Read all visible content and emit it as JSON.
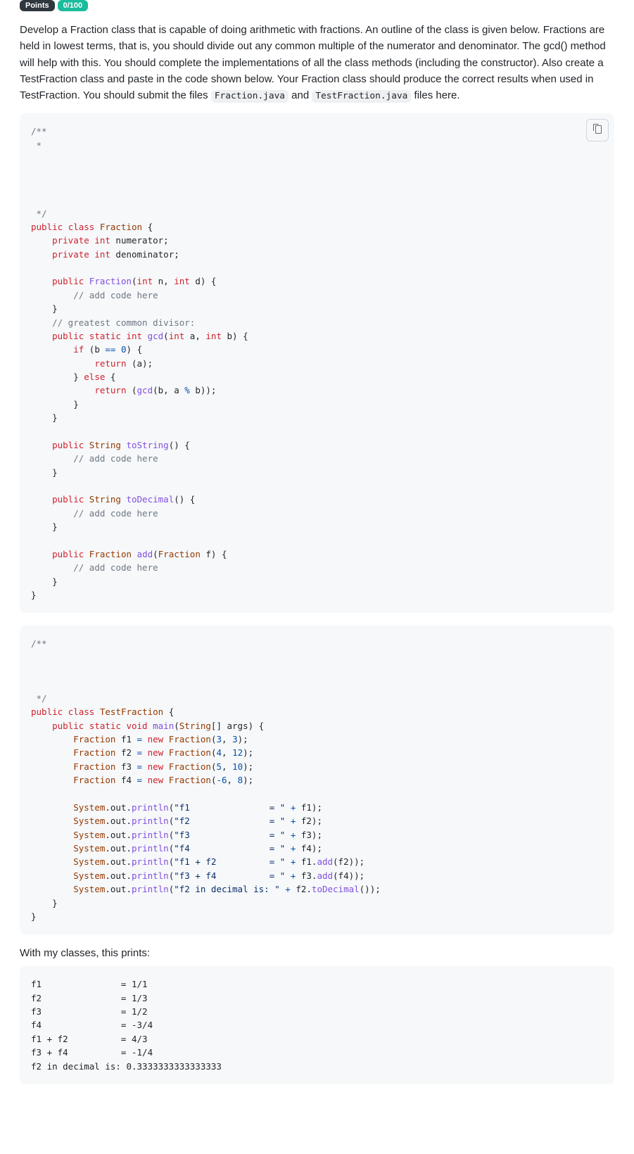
{
  "badges": [
    "Points",
    "0/100"
  ],
  "intro_parts": {
    "before_code1": "Develop a Fraction class that is capable of doing arithmetic with fractions. An outline of the class is given below. Fractions are held in lowest terms, that is, you should divide out any common multiple of the numerator and denominator. The gcd() method will help with this. You should complete the implementations of all the class methods (including the constructor). Also create a TestFraction class and paste in the code shown below. Your Fraction class should produce the correct results when used in TestFraction. You should submit the files ",
    "code1": "Fraction.java",
    "middle": " and ",
    "code2": "TestFraction.java",
    "after_code2": " files here."
  },
  "copy_btn_label": "Copy",
  "code1_tokens": [
    [
      "comment",
      "/**"
    ],
    [
      "nl"
    ],
    [
      "comment",
      " *"
    ],
    [
      "nl"
    ],
    [
      "nl"
    ],
    [
      "nl"
    ],
    [
      "nl"
    ],
    [
      "nl"
    ],
    [
      "comment",
      " */"
    ],
    [
      "nl"
    ],
    [
      "key",
      "public"
    ],
    [
      "plain",
      " "
    ],
    [
      "key",
      "class"
    ],
    [
      "plain",
      " "
    ],
    [
      "cls",
      "Fraction"
    ],
    [
      "plain",
      " {"
    ],
    [
      "nl"
    ],
    [
      "plain",
      "    "
    ],
    [
      "key",
      "private"
    ],
    [
      "plain",
      " "
    ],
    [
      "key",
      "int"
    ],
    [
      "plain",
      " numerator;"
    ],
    [
      "nl"
    ],
    [
      "plain",
      "    "
    ],
    [
      "key",
      "private"
    ],
    [
      "plain",
      " "
    ],
    [
      "key",
      "int"
    ],
    [
      "plain",
      " denominator;"
    ],
    [
      "nl"
    ],
    [
      "nl"
    ],
    [
      "plain",
      "    "
    ],
    [
      "key",
      "public"
    ],
    [
      "plain",
      " "
    ],
    [
      "fn",
      "Fraction"
    ],
    [
      "plain",
      "("
    ],
    [
      "key",
      "int"
    ],
    [
      "plain",
      " n, "
    ],
    [
      "key",
      "int"
    ],
    [
      "plain",
      " d) {"
    ],
    [
      "nl"
    ],
    [
      "plain",
      "        "
    ],
    [
      "comment",
      "// add code here"
    ],
    [
      "nl"
    ],
    [
      "plain",
      "    }"
    ],
    [
      "nl"
    ],
    [
      "plain",
      "    "
    ],
    [
      "comment",
      "// greatest common divisor:"
    ],
    [
      "nl"
    ],
    [
      "plain",
      "    "
    ],
    [
      "key",
      "public"
    ],
    [
      "plain",
      " "
    ],
    [
      "key",
      "static"
    ],
    [
      "plain",
      " "
    ],
    [
      "key",
      "int"
    ],
    [
      "plain",
      " "
    ],
    [
      "fn",
      "gcd"
    ],
    [
      "plain",
      "("
    ],
    [
      "key",
      "int"
    ],
    [
      "plain",
      " a, "
    ],
    [
      "key",
      "int"
    ],
    [
      "plain",
      " b) {"
    ],
    [
      "nl"
    ],
    [
      "plain",
      "        "
    ],
    [
      "key",
      "if"
    ],
    [
      "plain",
      " (b "
    ],
    [
      "op",
      "=="
    ],
    [
      "plain",
      " "
    ],
    [
      "num",
      "0"
    ],
    [
      "plain",
      ") {"
    ],
    [
      "nl"
    ],
    [
      "plain",
      "            "
    ],
    [
      "key",
      "return"
    ],
    [
      "plain",
      " (a);"
    ],
    [
      "nl"
    ],
    [
      "plain",
      "        } "
    ],
    [
      "key",
      "else"
    ],
    [
      "plain",
      " {"
    ],
    [
      "nl"
    ],
    [
      "plain",
      "            "
    ],
    [
      "key",
      "return"
    ],
    [
      "plain",
      " ("
    ],
    [
      "fn",
      "gcd"
    ],
    [
      "plain",
      "(b, a "
    ],
    [
      "op",
      "%"
    ],
    [
      "plain",
      " b));"
    ],
    [
      "nl"
    ],
    [
      "plain",
      "        }"
    ],
    [
      "nl"
    ],
    [
      "plain",
      "    }"
    ],
    [
      "nl"
    ],
    [
      "nl"
    ],
    [
      "plain",
      "    "
    ],
    [
      "key",
      "public"
    ],
    [
      "plain",
      " "
    ],
    [
      "cls",
      "String"
    ],
    [
      "plain",
      " "
    ],
    [
      "fn",
      "toString"
    ],
    [
      "plain",
      "() {"
    ],
    [
      "nl"
    ],
    [
      "plain",
      "        "
    ],
    [
      "comment",
      "// add code here"
    ],
    [
      "nl"
    ],
    [
      "plain",
      "    }"
    ],
    [
      "nl"
    ],
    [
      "nl"
    ],
    [
      "plain",
      "    "
    ],
    [
      "key",
      "public"
    ],
    [
      "plain",
      " "
    ],
    [
      "cls",
      "String"
    ],
    [
      "plain",
      " "
    ],
    [
      "fn",
      "toDecimal"
    ],
    [
      "plain",
      "() {"
    ],
    [
      "nl"
    ],
    [
      "plain",
      "        "
    ],
    [
      "comment",
      "// add code here"
    ],
    [
      "nl"
    ],
    [
      "plain",
      "    }"
    ],
    [
      "nl"
    ],
    [
      "nl"
    ],
    [
      "plain",
      "    "
    ],
    [
      "key",
      "public"
    ],
    [
      "plain",
      " "
    ],
    [
      "cls",
      "Fraction"
    ],
    [
      "plain",
      " "
    ],
    [
      "fn",
      "add"
    ],
    [
      "plain",
      "("
    ],
    [
      "cls",
      "Fraction"
    ],
    [
      "plain",
      " f) {"
    ],
    [
      "nl"
    ],
    [
      "plain",
      "        "
    ],
    [
      "comment",
      "// add code here"
    ],
    [
      "nl"
    ],
    [
      "plain",
      "    }"
    ],
    [
      "nl"
    ],
    [
      "plain",
      "}"
    ],
    [
      "nl"
    ]
  ],
  "code2_tokens": [
    [
      "comment",
      "/**"
    ],
    [
      "nl"
    ],
    [
      "nl"
    ],
    [
      "nl"
    ],
    [
      "nl"
    ],
    [
      "comment",
      " */"
    ],
    [
      "nl"
    ],
    [
      "key",
      "public"
    ],
    [
      "plain",
      " "
    ],
    [
      "key",
      "class"
    ],
    [
      "plain",
      " "
    ],
    [
      "cls",
      "TestFraction"
    ],
    [
      "plain",
      " {"
    ],
    [
      "nl"
    ],
    [
      "plain",
      "    "
    ],
    [
      "key",
      "public"
    ],
    [
      "plain",
      " "
    ],
    [
      "key",
      "static"
    ],
    [
      "plain",
      " "
    ],
    [
      "key",
      "void"
    ],
    [
      "plain",
      " "
    ],
    [
      "fn",
      "main"
    ],
    [
      "plain",
      "("
    ],
    [
      "cls",
      "String"
    ],
    [
      "plain",
      "[] args) {"
    ],
    [
      "nl"
    ],
    [
      "plain",
      "        "
    ],
    [
      "cls",
      "Fraction"
    ],
    [
      "plain",
      " f1 "
    ],
    [
      "op",
      "="
    ],
    [
      "plain",
      " "
    ],
    [
      "key",
      "new"
    ],
    [
      "plain",
      " "
    ],
    [
      "cls",
      "Fraction"
    ],
    [
      "plain",
      "("
    ],
    [
      "num",
      "3"
    ],
    [
      "plain",
      ", "
    ],
    [
      "num",
      "3"
    ],
    [
      "plain",
      ");"
    ],
    [
      "nl"
    ],
    [
      "plain",
      "        "
    ],
    [
      "cls",
      "Fraction"
    ],
    [
      "plain",
      " f2 "
    ],
    [
      "op",
      "="
    ],
    [
      "plain",
      " "
    ],
    [
      "key",
      "new"
    ],
    [
      "plain",
      " "
    ],
    [
      "cls",
      "Fraction"
    ],
    [
      "plain",
      "("
    ],
    [
      "num",
      "4"
    ],
    [
      "plain",
      ", "
    ],
    [
      "num",
      "12"
    ],
    [
      "plain",
      ");"
    ],
    [
      "nl"
    ],
    [
      "plain",
      "        "
    ],
    [
      "cls",
      "Fraction"
    ],
    [
      "plain",
      " f3 "
    ],
    [
      "op",
      "="
    ],
    [
      "plain",
      " "
    ],
    [
      "key",
      "new"
    ],
    [
      "plain",
      " "
    ],
    [
      "cls",
      "Fraction"
    ],
    [
      "plain",
      "("
    ],
    [
      "num",
      "5"
    ],
    [
      "plain",
      ", "
    ],
    [
      "num",
      "10"
    ],
    [
      "plain",
      ");"
    ],
    [
      "nl"
    ],
    [
      "plain",
      "        "
    ],
    [
      "cls",
      "Fraction"
    ],
    [
      "plain",
      " f4 "
    ],
    [
      "op",
      "="
    ],
    [
      "plain",
      " "
    ],
    [
      "key",
      "new"
    ],
    [
      "plain",
      " "
    ],
    [
      "cls",
      "Fraction"
    ],
    [
      "plain",
      "("
    ],
    [
      "op",
      "-"
    ],
    [
      "num",
      "6"
    ],
    [
      "plain",
      ", "
    ],
    [
      "num",
      "8"
    ],
    [
      "plain",
      ");"
    ],
    [
      "nl"
    ],
    [
      "nl"
    ],
    [
      "plain",
      "        "
    ],
    [
      "cls",
      "System"
    ],
    [
      "plain",
      ".out."
    ],
    [
      "fn",
      "println"
    ],
    [
      "plain",
      "("
    ],
    [
      "str",
      "\"f1               = \""
    ],
    [
      "plain",
      " "
    ],
    [
      "op",
      "+"
    ],
    [
      "plain",
      " f1);"
    ],
    [
      "nl"
    ],
    [
      "plain",
      "        "
    ],
    [
      "cls",
      "System"
    ],
    [
      "plain",
      ".out."
    ],
    [
      "fn",
      "println"
    ],
    [
      "plain",
      "("
    ],
    [
      "str",
      "\"f2               = \""
    ],
    [
      "plain",
      " "
    ],
    [
      "op",
      "+"
    ],
    [
      "plain",
      " f2);"
    ],
    [
      "nl"
    ],
    [
      "plain",
      "        "
    ],
    [
      "cls",
      "System"
    ],
    [
      "plain",
      ".out."
    ],
    [
      "fn",
      "println"
    ],
    [
      "plain",
      "("
    ],
    [
      "str",
      "\"f3               = \""
    ],
    [
      "plain",
      " "
    ],
    [
      "op",
      "+"
    ],
    [
      "plain",
      " f3);"
    ],
    [
      "nl"
    ],
    [
      "plain",
      "        "
    ],
    [
      "cls",
      "System"
    ],
    [
      "plain",
      ".out."
    ],
    [
      "fn",
      "println"
    ],
    [
      "plain",
      "("
    ],
    [
      "str",
      "\"f4               = \""
    ],
    [
      "plain",
      " "
    ],
    [
      "op",
      "+"
    ],
    [
      "plain",
      " f4);"
    ],
    [
      "nl"
    ],
    [
      "plain",
      "        "
    ],
    [
      "cls",
      "System"
    ],
    [
      "plain",
      ".out."
    ],
    [
      "fn",
      "println"
    ],
    [
      "plain",
      "("
    ],
    [
      "str",
      "\"f1 + f2          = \""
    ],
    [
      "plain",
      " "
    ],
    [
      "op",
      "+"
    ],
    [
      "plain",
      " f1."
    ],
    [
      "fn",
      "add"
    ],
    [
      "plain",
      "(f2));"
    ],
    [
      "nl"
    ],
    [
      "plain",
      "        "
    ],
    [
      "cls",
      "System"
    ],
    [
      "plain",
      ".out."
    ],
    [
      "fn",
      "println"
    ],
    [
      "plain",
      "("
    ],
    [
      "str",
      "\"f3 + f4          = \""
    ],
    [
      "plain",
      " "
    ],
    [
      "op",
      "+"
    ],
    [
      "plain",
      " f3."
    ],
    [
      "fn",
      "add"
    ],
    [
      "plain",
      "(f4));"
    ],
    [
      "nl"
    ],
    [
      "plain",
      "        "
    ],
    [
      "cls",
      "System"
    ],
    [
      "plain",
      ".out."
    ],
    [
      "fn",
      "println"
    ],
    [
      "plain",
      "("
    ],
    [
      "str",
      "\"f2 in decimal is: \""
    ],
    [
      "plain",
      " "
    ],
    [
      "op",
      "+"
    ],
    [
      "plain",
      " f2."
    ],
    [
      "fn",
      "toDecimal"
    ],
    [
      "plain",
      "());"
    ],
    [
      "nl"
    ],
    [
      "plain",
      "    }"
    ],
    [
      "nl"
    ],
    [
      "plain",
      "}"
    ],
    [
      "nl"
    ]
  ],
  "output_heading": "With my classes, this prints:",
  "output_text": "f1               = 1/1\nf2               = 1/3\nf3               = 1/2\nf4               = -3/4\nf1 + f2          = 4/3\nf3 + f4          = -1/4\nf2 in decimal is: 0.3333333333333333"
}
